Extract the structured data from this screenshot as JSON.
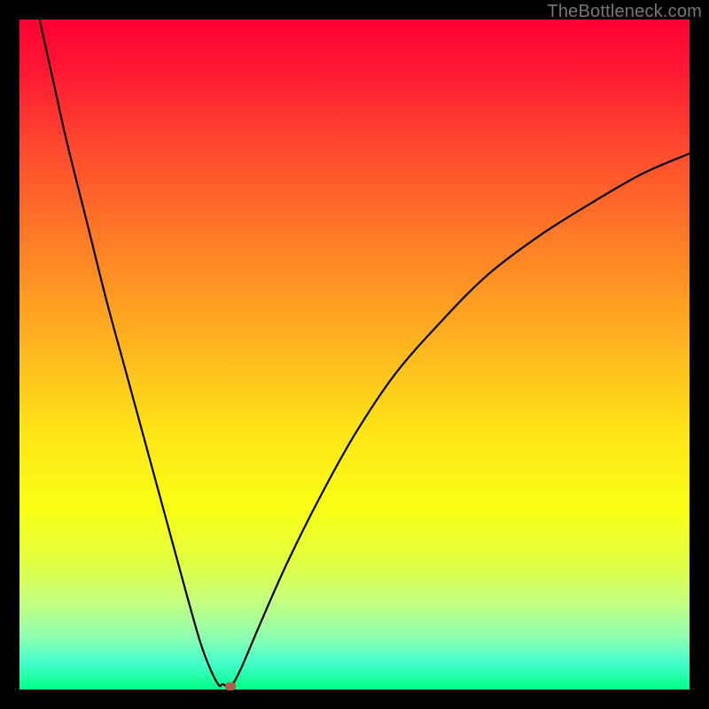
{
  "watermark": "TheBottleneck.com",
  "colors": {
    "frame": "#000000",
    "curve": "#000000",
    "marker": "#b75a4d"
  },
  "chart_data": {
    "type": "line",
    "title": "",
    "xlabel": "",
    "ylabel": "",
    "xlim": [
      0,
      100
    ],
    "ylim": [
      0,
      100
    ],
    "series": [
      {
        "name": "bottleneck-curve",
        "x": [
          3,
          5,
          7,
          10,
          13,
          16,
          19,
          22,
          25,
          27,
          28.5,
          29.8,
          30.3,
          31.5,
          33,
          36,
          40,
          45,
          50,
          56,
          63,
          70,
          78,
          86,
          93,
          100
        ],
        "y": [
          100,
          91,
          82,
          70,
          58,
          47,
          36,
          25,
          14,
          7,
          3,
          0.6,
          0.8,
          0.5,
          3,
          10,
          19,
          29,
          38,
          47,
          55,
          62,
          68,
          73,
          77,
          80
        ]
      }
    ],
    "annotations": [
      {
        "type": "marker",
        "x": 31.5,
        "y": 0.5,
        "label": "optimal-point"
      }
    ],
    "gradient_background": true
  }
}
